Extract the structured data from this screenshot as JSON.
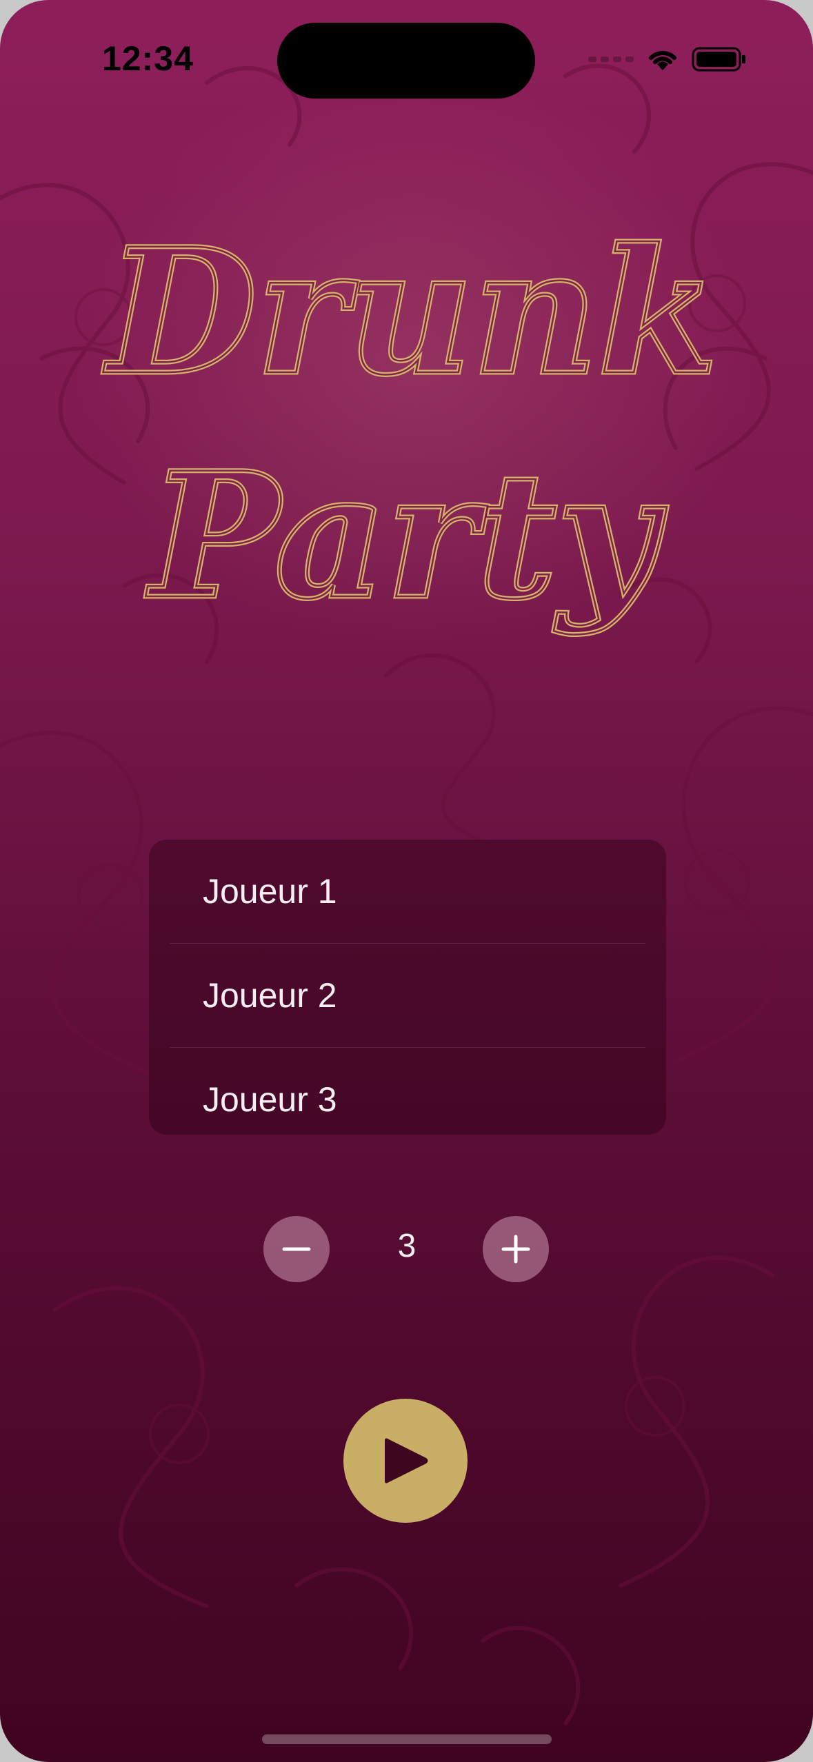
{
  "status_bar": {
    "time": "12:34"
  },
  "title": {
    "line1": "Drunk",
    "line2": "Party",
    "color": "#d6b36a"
  },
  "players": [
    {
      "label": "Joueur 1"
    },
    {
      "label": "Joueur 2"
    },
    {
      "label": "Joueur 3"
    }
  ],
  "stepper": {
    "value": "3",
    "minus_icon": "minus-icon",
    "plus_icon": "plus-icon"
  },
  "play_button": {
    "icon": "play-icon",
    "color": "#c9af66"
  },
  "colors": {
    "background_top": "#8e1e5a",
    "background_bottom": "#3f0420"
  }
}
